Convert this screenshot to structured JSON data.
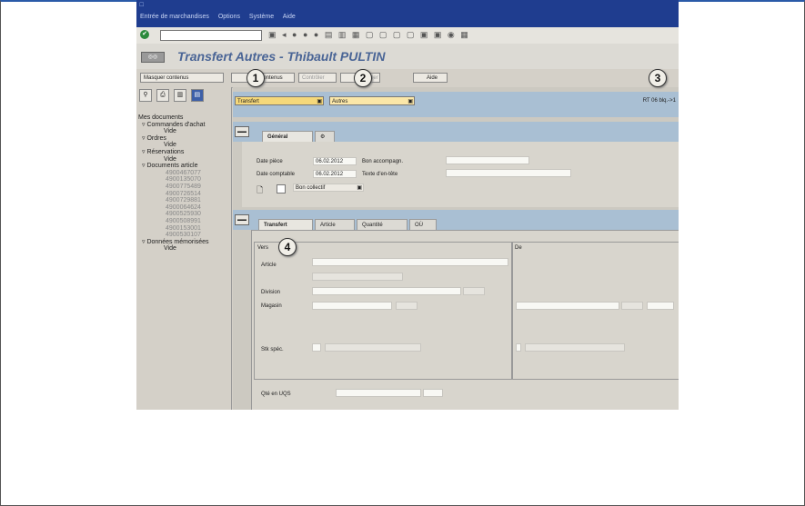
{
  "menubar": {
    "items": [
      "Entrée de marchandises",
      "Options",
      "Système",
      "Aide"
    ]
  },
  "title": "Transfert Autres - Thibault PULTIN",
  "appbar": {
    "hide_overview": "Masquer contenus",
    "content": "Contenus",
    "check": "Contrôler",
    "post": "Publier",
    "help": "Aide"
  },
  "header": {
    "transaction": "Transfert",
    "movement": "Autres",
    "mvt_type": "RT 06 blq.->1"
  },
  "tabs_top": {
    "general": "Général",
    "icon_tab": "⚙"
  },
  "general": {
    "doc_date_label": "Date pièce",
    "doc_date": "06.02.2012",
    "posting_date_label": "Date comptable",
    "posting_date": "06.02.2012",
    "delivery_note_label": "Bon accompagn.",
    "header_text_label": "Texte d'en-tête",
    "collective_slip": "Bon collectif"
  },
  "tabs_item": {
    "transfer": "Transfert",
    "article": "Article",
    "quantity": "Quantité",
    "where": "OÙ"
  },
  "transfer": {
    "from_label": "Vers",
    "to_label": "De",
    "article_label": "Article",
    "division_label": "Division",
    "store_label": "Magasin",
    "stock_label": "Stk spéc.",
    "qty_label": "Qté en UQS"
  },
  "sidebar": {
    "title": "Mes documents",
    "nodes": [
      {
        "label": "Commandes d'achat",
        "children": [
          "Vide"
        ]
      },
      {
        "label": "Ordres",
        "children": [
          "Vide"
        ]
      },
      {
        "label": "Réservations",
        "children": [
          "Vide"
        ]
      },
      {
        "label": "Documents article",
        "children": [
          "4900467077",
          "4900135070",
          "4900775489",
          "4900726514",
          "4900729881",
          "4900064624",
          "4900525930",
          "4900508991",
          "4900153001",
          "4900530107"
        ]
      },
      {
        "label": "Données mémorisées",
        "children": [
          "Vide"
        ]
      }
    ]
  },
  "callouts": [
    "1",
    "2",
    "3",
    "4"
  ]
}
